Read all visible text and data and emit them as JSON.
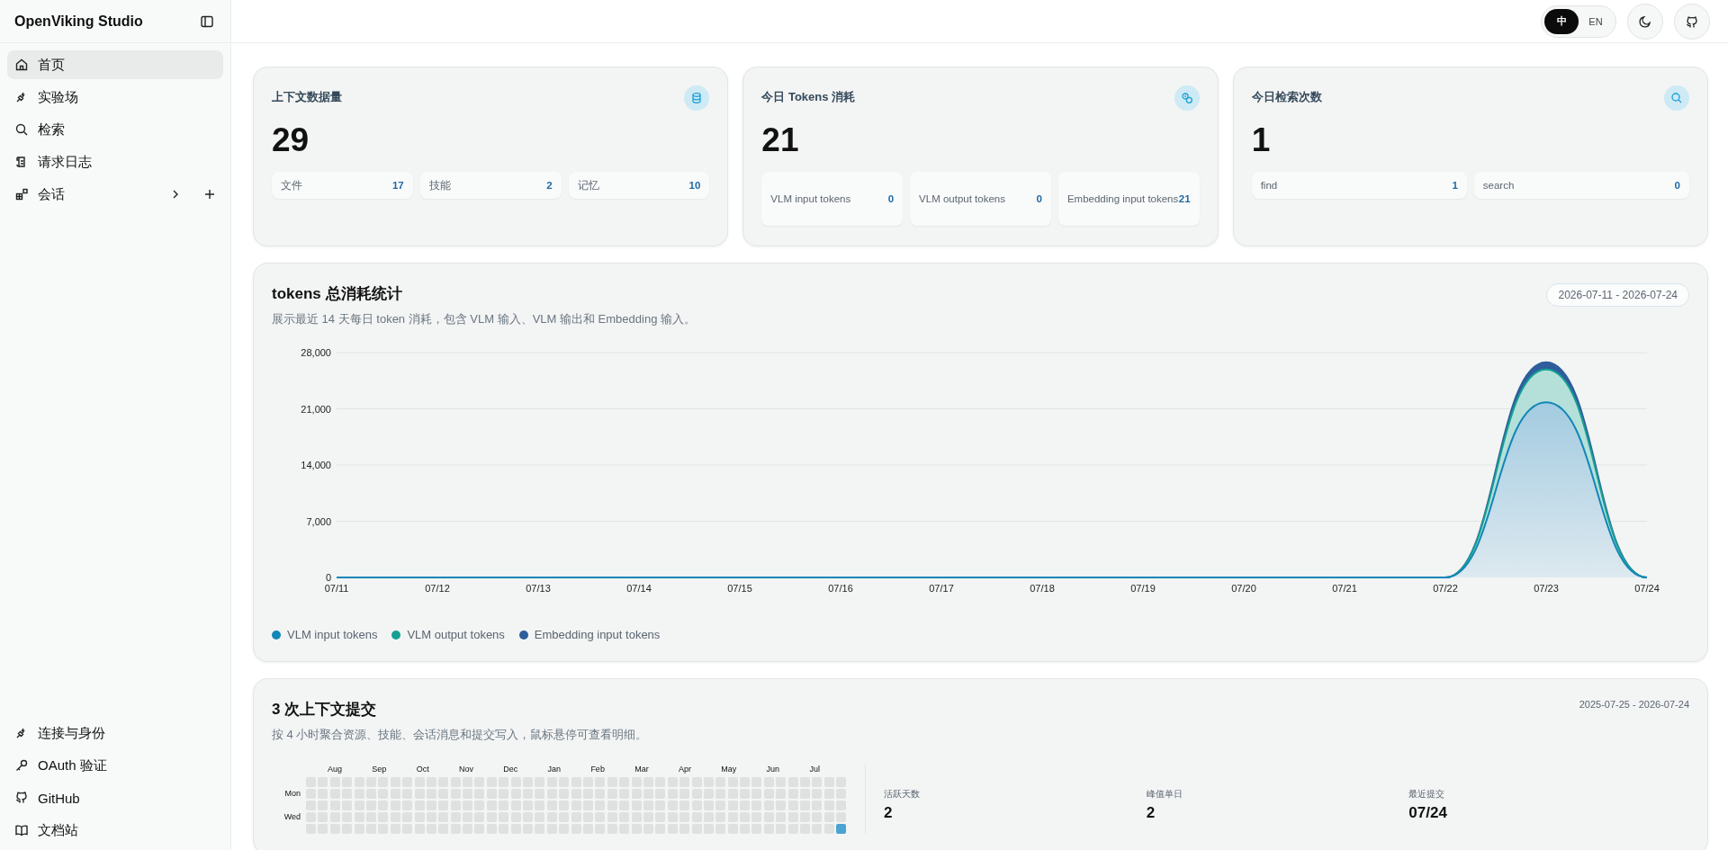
{
  "sidebar": {
    "brand": "OpenViking Studio",
    "nav": [
      {
        "label": "首页",
        "selected": true,
        "has_children": false
      },
      {
        "label": "实验场",
        "selected": false,
        "has_children": false
      },
      {
        "label": "检索",
        "selected": false,
        "has_children": false
      },
      {
        "label": "请求日志",
        "selected": false,
        "has_children": false
      },
      {
        "label": "会话",
        "selected": false,
        "has_children": true
      }
    ],
    "footer": [
      {
        "label": "连接与身份"
      },
      {
        "label": "OAuth 验证"
      },
      {
        "label": "GitHub"
      },
      {
        "label": "文档站"
      }
    ]
  },
  "topbar": {
    "languages": [
      {
        "label": "中",
        "selected": true
      },
      {
        "label": "EN",
        "selected": false
      }
    ]
  },
  "stat_cards": [
    {
      "title": "上下文数据量",
      "value": "29",
      "items": [
        {
          "label": "文件",
          "value": "17"
        },
        {
          "label": "技能",
          "value": "2"
        },
        {
          "label": "记忆",
          "value": "10"
        }
      ]
    },
    {
      "title": "今日 Tokens 消耗",
      "value": "21",
      "items": [
        {
          "label": "VLM input tokens",
          "value": "0"
        },
        {
          "label": "VLM output tokens",
          "value": "0"
        },
        {
          "label": "Embedding input tokens",
          "value": "21"
        }
      ]
    },
    {
      "title": "今日检索次数",
      "value": "1",
      "items": [
        {
          "label": "find",
          "value": "1"
        },
        {
          "label": "search",
          "value": "0"
        }
      ]
    }
  ],
  "token_chart": {
    "title": "tokens 总消耗统计",
    "subtitle": "展示最近 14 天每日 token 消耗，包含 VLM 输入、VLM 输出和 Embedding 输入。",
    "date_range": "2026-07-11 - 2026-07-24",
    "chart_data": {
      "type": "area",
      "stacked": true,
      "grid": true,
      "categories": [
        "07/11",
        "07/12",
        "07/13",
        "07/14",
        "07/15",
        "07/16",
        "07/17",
        "07/18",
        "07/19",
        "07/20",
        "07/21",
        "07/22",
        "07/23",
        "07/24"
      ],
      "series": [
        {
          "name": "VLM input tokens",
          "color": "#1286b8",
          "values": [
            0,
            0,
            0,
            0,
            0,
            0,
            0,
            0,
            0,
            0,
            0,
            0,
            21800,
            0
          ]
        },
        {
          "name": "VLM output tokens",
          "color": "#16a093",
          "values": [
            0,
            0,
            0,
            0,
            0,
            0,
            0,
            0,
            0,
            0,
            0,
            0,
            4100,
            0
          ]
        },
        {
          "name": "Embedding input tokens",
          "color": "#2e5e9c",
          "values": [
            0,
            0,
            0,
            0,
            0,
            0,
            0,
            0,
            0,
            0,
            0,
            0,
            900,
            0
          ]
        }
      ],
      "ylim": [
        0,
        28000
      ],
      "yticks": [
        {
          "value": 0,
          "label": "0"
        },
        {
          "value": 7000,
          "label": "7,000"
        },
        {
          "value": 14000,
          "label": "14,000"
        },
        {
          "value": 21000,
          "label": "21,000"
        },
        {
          "value": 28000,
          "label": "28,000"
        }
      ]
    }
  },
  "commits": {
    "title": "3 次上下文提交",
    "subtitle": "按 4 小时聚合资源、技能、会话消息和提交写入，鼠标悬停可查看明细。",
    "date_range": "2025-07-25 - 2026-07-24",
    "heatmap": {
      "months": [
        "Aug",
        "Sep",
        "Oct",
        "Nov",
        "Dec",
        "Jan",
        "Feb",
        "Mar",
        "Apr",
        "May",
        "Jun",
        "Jul"
      ],
      "day_labels": [
        "Mon",
        "Wed"
      ],
      "rows": [
        {
          "cells": [
            {
              "color": "#dfe1e1"
            },
            {
              "color": "#dfe1e1"
            },
            {
              "color": "#dfe1e1"
            },
            {
              "color": "#dfe1e1"
            },
            {
              "color": "#dfe1e1"
            },
            {
              "color": "#dfe1e1"
            },
            {
              "color": "#dfe1e1"
            },
            {
              "color": "#dfe1e1"
            },
            {
              "color": "#dfe1e1"
            },
            {
              "color": "#dfe1e1"
            },
            {
              "color": "#dfe1e1"
            },
            {
              "color": "#dfe1e1"
            },
            {
              "color": "#dfe1e1"
            },
            {
              "color": "#dfe1e1"
            },
            {
              "color": "#dfe1e1"
            },
            {
              "color": "#dfe1e1"
            },
            {
              "color": "#dfe1e1"
            },
            {
              "color": "#dfe1e1"
            },
            {
              "color": "#dfe1e1"
            },
            {
              "color": "#dfe1e1"
            },
            {
              "color": "#dfe1e1"
            },
            {
              "color": "#dfe1e1"
            },
            {
              "color": "#dfe1e1"
            },
            {
              "color": "#dfe1e1"
            },
            {
              "color": "#dfe1e1"
            },
            {
              "color": "#dfe1e1"
            },
            {
              "color": "#dfe1e1"
            },
            {
              "color": "#dfe1e1"
            },
            {
              "color": "#dfe1e1"
            },
            {
              "color": "#dfe1e1"
            },
            {
              "color": "#dfe1e1"
            },
            {
              "color": "#dfe1e1"
            },
            {
              "color": "#dfe1e1"
            },
            {
              "color": "#dfe1e1"
            },
            {
              "color": "#dfe1e1"
            },
            {
              "color": "#dfe1e1"
            },
            {
              "color": "#dfe1e1"
            },
            {
              "color": "#dfe1e1"
            },
            {
              "color": "#dfe1e1"
            },
            {
              "color": "#dfe1e1"
            },
            {
              "color": "#dfe1e1"
            },
            {
              "color": "#dfe1e1"
            },
            {
              "color": "#dfe1e1"
            },
            {
              "color": "#dfe1e1"
            },
            {
              "color": "#dfe1e1"
            }
          ]
        },
        {
          "cells": [
            {
              "color": "#dfe1e1"
            },
            {
              "color": "#dfe1e1"
            },
            {
              "color": "#dfe1e1"
            },
            {
              "color": "#dfe1e1"
            },
            {
              "color": "#dfe1e1"
            },
            {
              "color": "#dfe1e1"
            },
            {
              "color": "#dfe1e1"
            },
            {
              "color": "#dfe1e1"
            },
            {
              "color": "#dfe1e1"
            },
            {
              "color": "#dfe1e1"
            },
            {
              "color": "#dfe1e1"
            },
            {
              "color": "#dfe1e1"
            },
            {
              "color": "#dfe1e1"
            },
            {
              "color": "#dfe1e1"
            },
            {
              "color": "#dfe1e1"
            },
            {
              "color": "#dfe1e1"
            },
            {
              "color": "#dfe1e1"
            },
            {
              "color": "#dfe1e1"
            },
            {
              "color": "#dfe1e1"
            },
            {
              "color": "#dfe1e1"
            },
            {
              "color": "#dfe1e1"
            },
            {
              "color": "#dfe1e1"
            },
            {
              "color": "#dfe1e1"
            },
            {
              "color": "#dfe1e1"
            },
            {
              "color": "#dfe1e1"
            },
            {
              "color": "#dfe1e1"
            },
            {
              "color": "#dfe1e1"
            },
            {
              "color": "#dfe1e1"
            },
            {
              "color": "#dfe1e1"
            },
            {
              "color": "#dfe1e1"
            },
            {
              "color": "#dfe1e1"
            },
            {
              "color": "#dfe1e1"
            },
            {
              "color": "#dfe1e1"
            },
            {
              "color": "#dfe1e1"
            },
            {
              "color": "#dfe1e1"
            },
            {
              "color": "#dfe1e1"
            },
            {
              "color": "#dfe1e1"
            },
            {
              "color": "#dfe1e1"
            },
            {
              "color": "#dfe1e1"
            },
            {
              "color": "#dfe1e1"
            },
            {
              "color": "#dfe1e1"
            },
            {
              "color": "#dfe1e1"
            },
            {
              "color": "#dfe1e1"
            },
            {
              "color": "#dfe1e1"
            },
            {
              "color": "#dfe1e1"
            }
          ]
        },
        {
          "cells": [
            {
              "color": "#dfe1e1"
            },
            {
              "color": "#dfe1e1"
            },
            {
              "color": "#dfe1e1"
            },
            {
              "color": "#dfe1e1"
            },
            {
              "color": "#dfe1e1"
            },
            {
              "color": "#dfe1e1"
            },
            {
              "color": "#dfe1e1"
            },
            {
              "color": "#dfe1e1"
            },
            {
              "color": "#dfe1e1"
            },
            {
              "color": "#dfe1e1"
            },
            {
              "color": "#dfe1e1"
            },
            {
              "color": "#dfe1e1"
            },
            {
              "color": "#dfe1e1"
            },
            {
              "color": "#dfe1e1"
            },
            {
              "color": "#dfe1e1"
            },
            {
              "color": "#dfe1e1"
            },
            {
              "color": "#dfe1e1"
            },
            {
              "color": "#dfe1e1"
            },
            {
              "color": "#dfe1e1"
            },
            {
              "color": "#dfe1e1"
            },
            {
              "color": "#dfe1e1"
            },
            {
              "color": "#dfe1e1"
            },
            {
              "color": "#dfe1e1"
            },
            {
              "color": "#dfe1e1"
            },
            {
              "color": "#dfe1e1"
            },
            {
              "color": "#dfe1e1"
            },
            {
              "color": "#dfe1e1"
            },
            {
              "color": "#dfe1e1"
            },
            {
              "color": "#dfe1e1"
            },
            {
              "color": "#dfe1e1"
            },
            {
              "color": "#dfe1e1"
            },
            {
              "color": "#dfe1e1"
            },
            {
              "color": "#dfe1e1"
            },
            {
              "color": "#dfe1e1"
            },
            {
              "color": "#dfe1e1"
            },
            {
              "color": "#dfe1e1"
            },
            {
              "color": "#dfe1e1"
            },
            {
              "color": "#dfe1e1"
            },
            {
              "color": "#dfe1e1"
            },
            {
              "color": "#dfe1e1"
            },
            {
              "color": "#dfe1e1"
            },
            {
              "color": "#dfe1e1"
            },
            {
              "color": "#dfe1e1"
            },
            {
              "color": "#dfe1e1"
            },
            {
              "color": "#dfe1e1"
            }
          ]
        },
        {
          "cells": [
            {
              "color": "#dfe1e1"
            },
            {
              "color": "#dfe1e1"
            },
            {
              "color": "#dfe1e1"
            },
            {
              "color": "#dfe1e1"
            },
            {
              "color": "#dfe1e1"
            },
            {
              "color": "#dfe1e1"
            },
            {
              "color": "#dfe1e1"
            },
            {
              "color": "#dfe1e1"
            },
            {
              "color": "#dfe1e1"
            },
            {
              "color": "#dfe1e1"
            },
            {
              "color": "#dfe1e1"
            },
            {
              "color": "#dfe1e1"
            },
            {
              "color": "#dfe1e1"
            },
            {
              "color": "#dfe1e1"
            },
            {
              "color": "#dfe1e1"
            },
            {
              "color": "#dfe1e1"
            },
            {
              "color": "#dfe1e1"
            },
            {
              "color": "#dfe1e1"
            },
            {
              "color": "#dfe1e1"
            },
            {
              "color": "#dfe1e1"
            },
            {
              "color": "#dfe1e1"
            },
            {
              "color": "#dfe1e1"
            },
            {
              "color": "#dfe1e1"
            },
            {
              "color": "#dfe1e1"
            },
            {
              "color": "#dfe1e1"
            },
            {
              "color": "#dfe1e1"
            },
            {
              "color": "#dfe1e1"
            },
            {
              "color": "#dfe1e1"
            },
            {
              "color": "#dfe1e1"
            },
            {
              "color": "#dfe1e1"
            },
            {
              "color": "#dfe1e1"
            },
            {
              "color": "#dfe1e1"
            },
            {
              "color": "#dfe1e1"
            },
            {
              "color": "#dfe1e1"
            },
            {
              "color": "#dfe1e1"
            },
            {
              "color": "#dfe1e1"
            },
            {
              "color": "#dfe1e1"
            },
            {
              "color": "#dfe1e1"
            },
            {
              "color": "#dfe1e1"
            },
            {
              "color": "#dfe1e1"
            },
            {
              "color": "#dfe1e1"
            },
            {
              "color": "#dfe1e1"
            },
            {
              "color": "#dfe1e1"
            },
            {
              "color": "#dfe1e1"
            },
            {
              "color": "#dfe1e1"
            }
          ]
        },
        {
          "cells": [
            {
              "color": "#dfe1e1"
            },
            {
              "color": "#dfe1e1"
            },
            {
              "color": "#dfe1e1"
            },
            {
              "color": "#dfe1e1"
            },
            {
              "color": "#dfe1e1"
            },
            {
              "color": "#dfe1e1"
            },
            {
              "color": "#dfe1e1"
            },
            {
              "color": "#dfe1e1"
            },
            {
              "color": "#dfe1e1"
            },
            {
              "color": "#dfe1e1"
            },
            {
              "color": "#dfe1e1"
            },
            {
              "color": "#dfe1e1"
            },
            {
              "color": "#dfe1e1"
            },
            {
              "color": "#dfe1e1"
            },
            {
              "color": "#dfe1e1"
            },
            {
              "color": "#dfe1e1"
            },
            {
              "color": "#dfe1e1"
            },
            {
              "color": "#dfe1e1"
            },
            {
              "color": "#dfe1e1"
            },
            {
              "color": "#dfe1e1"
            },
            {
              "color": "#dfe1e1"
            },
            {
              "color": "#dfe1e1"
            },
            {
              "color": "#dfe1e1"
            },
            {
              "color": "#dfe1e1"
            },
            {
              "color": "#dfe1e1"
            },
            {
              "color": "#dfe1e1"
            },
            {
              "color": "#dfe1e1"
            },
            {
              "color": "#dfe1e1"
            },
            {
              "color": "#dfe1e1"
            },
            {
              "color": "#dfe1e1"
            },
            {
              "color": "#dfe1e1"
            },
            {
              "color": "#dfe1e1"
            },
            {
              "color": "#dfe1e1"
            },
            {
              "color": "#dfe1e1"
            },
            {
              "color": "#dfe1e1"
            },
            {
              "color": "#dfe1e1"
            },
            {
              "color": "#dfe1e1"
            },
            {
              "color": "#dfe1e1"
            },
            {
              "color": "#dfe1e1"
            },
            {
              "color": "#dfe1e1"
            },
            {
              "color": "#dfe1e1"
            },
            {
              "color": "#dfe1e1"
            },
            {
              "color": "#dfe1e1"
            },
            {
              "color": "#dfe1e1"
            },
            {
              "color": "#4aa3d0"
            }
          ]
        }
      ]
    },
    "stats": [
      {
        "label": "活跃天数",
        "value": "2"
      },
      {
        "label": "峰值单日",
        "value": "2"
      },
      {
        "label": "最近提交",
        "value": "07/24"
      }
    ]
  }
}
